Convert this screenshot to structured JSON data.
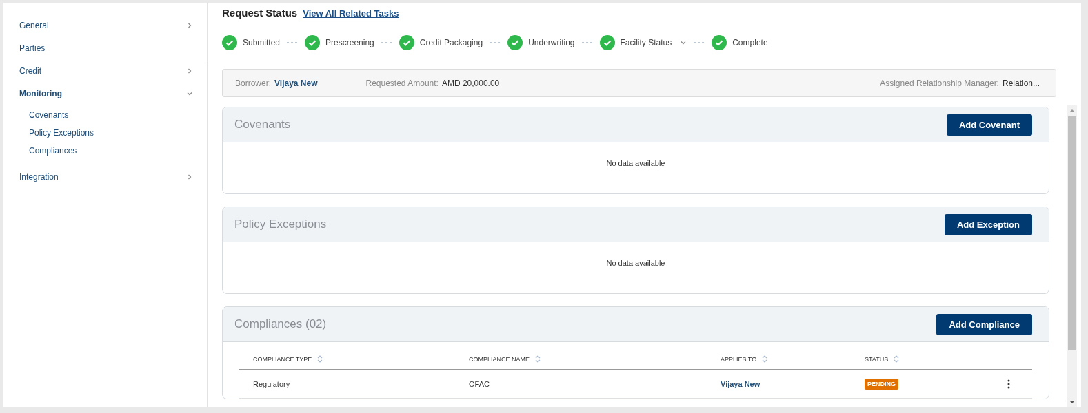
{
  "sidebar": {
    "items": [
      {
        "label": "General",
        "expanded": false,
        "selected": false
      },
      {
        "label": "Parties",
        "selected": false
      },
      {
        "label": "Credit",
        "expanded": false,
        "selected": false
      },
      {
        "label": "Monitoring",
        "expanded": true,
        "selected": true,
        "children": [
          {
            "label": "Covenants"
          },
          {
            "label": "Policy Exceptions"
          },
          {
            "label": "Compliances"
          }
        ]
      },
      {
        "label": "Integration",
        "expanded": false,
        "selected": false
      }
    ]
  },
  "header": {
    "title": "Request Status",
    "link": "View All Related Tasks"
  },
  "steps": [
    {
      "label": "Submitted",
      "done": true,
      "dropdown": false
    },
    {
      "label": "Prescreening",
      "done": true,
      "dropdown": false
    },
    {
      "label": "Credit Packaging",
      "done": true,
      "dropdown": false
    },
    {
      "label": "Underwriting",
      "done": true,
      "dropdown": false
    },
    {
      "label": "Facility Status",
      "done": true,
      "dropdown": true
    },
    {
      "label": "Complete",
      "done": true,
      "dropdown": false
    }
  ],
  "summary": [
    {
      "label": "Borrower:",
      "value": "Vijaya New",
      "kind": "link"
    },
    {
      "label": "Requested Amount:",
      "value": "AMD 20,000.00",
      "kind": "plain"
    },
    {
      "label": "Assigned Relationship Manager:",
      "value": "Relation...",
      "kind": "plain"
    }
  ],
  "sections": [
    {
      "title": "Covenants",
      "button": "Add Covenant",
      "empty_text": "No data available"
    },
    {
      "title": "Policy Exceptions",
      "button": "Add Exception",
      "empty_text": "No data available"
    },
    {
      "title": "Compliances (02)",
      "button": "Add Compliance",
      "table": {
        "columns": [
          "COMPLIANCE TYPE",
          "COMPLIANCE NAME",
          "APPLIES TO",
          "STATUS"
        ],
        "rows": [
          {
            "type": "Regulatory",
            "name": "OFAC",
            "applies_to": "Vijaya New",
            "status": "PENDING",
            "color": "#e07000"
          }
        ]
      }
    }
  ]
}
